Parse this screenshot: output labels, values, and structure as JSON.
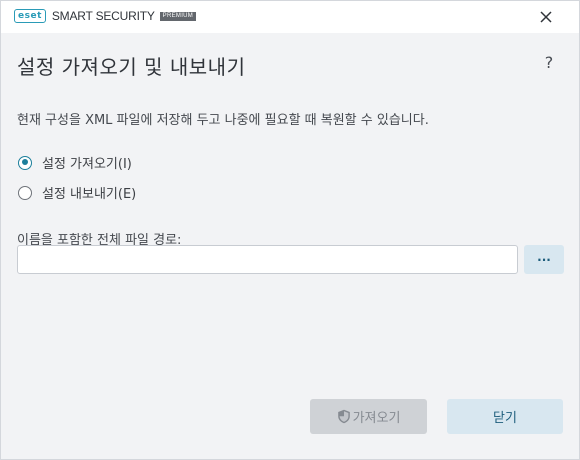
{
  "window": {
    "brand_logo": "eset",
    "product_name": "SMART SECURITY",
    "product_edition": "PREMIUM",
    "close_icon": "close-icon"
  },
  "header": {
    "title": "설정 가져오기 및 내보내기",
    "help_label": "?"
  },
  "description": "현재 구성을 XML 파일에 저장해 두고 나중에 필요할 때 복원할 수 있습니다.",
  "options": [
    {
      "label": "설정 가져오기(I)",
      "selected": true
    },
    {
      "label": "설정 내보내기(E)",
      "selected": false
    }
  ],
  "path_field": {
    "label": "이름을 포함한 전체 파일 경로:",
    "value": "",
    "browse_label": "..."
  },
  "footer": {
    "import_label": "가져오기",
    "import_enabled": false,
    "import_icon": "shield-icon",
    "close_label": "닫기"
  },
  "colors": {
    "accent": "#1c7f9b",
    "brand": "#2a9bb7",
    "secondary_button_bg": "#d8e7f0",
    "disabled_button_bg": "#cfd2d6"
  }
}
